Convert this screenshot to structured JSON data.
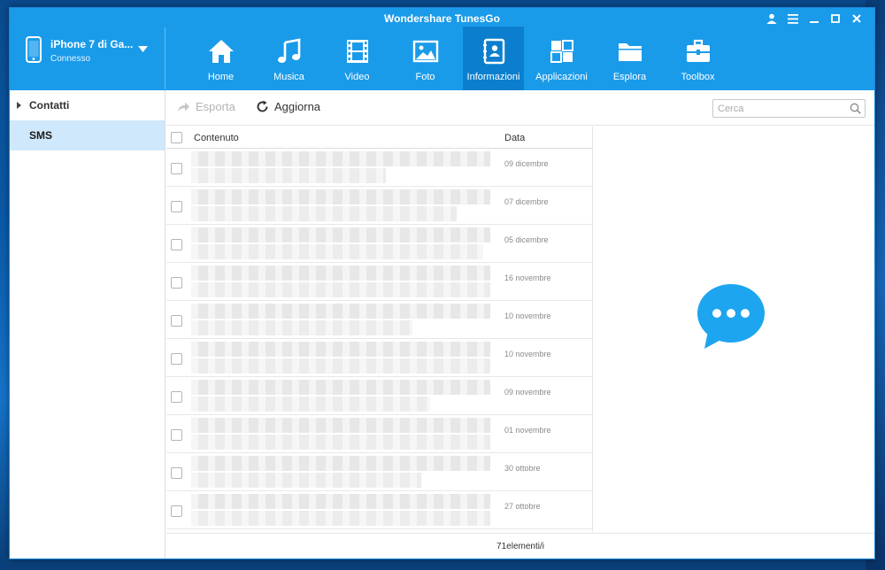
{
  "app": {
    "title": "Wondershare TunesGo"
  },
  "device": {
    "name": "iPhone 7 di Ga...",
    "status": "Connesso"
  },
  "nav": [
    {
      "label": "Home",
      "icon": "home-icon"
    },
    {
      "label": "Musica",
      "icon": "music-icon"
    },
    {
      "label": "Video",
      "icon": "film-icon"
    },
    {
      "label": "Foto",
      "icon": "photo-icon"
    },
    {
      "label": "Informazioni",
      "icon": "contacts-book-icon",
      "active": true
    },
    {
      "label": "Applicazioni",
      "icon": "apps-grid-icon"
    },
    {
      "label": "Esplora",
      "icon": "folder-icon"
    },
    {
      "label": "Toolbox",
      "icon": "toolbox-icon"
    }
  ],
  "sidebar": {
    "items": [
      {
        "label": "Contatti",
        "expandable": true
      },
      {
        "label": "SMS",
        "selected": true
      }
    ]
  },
  "toolbar": {
    "export_label": "Esporta",
    "refresh_label": "Aggiorna",
    "search_placeholder": "Cerca"
  },
  "list": {
    "columns": {
      "content": "Contenuto",
      "date": "Data"
    },
    "rows": [
      {
        "date": "09 dicembre"
      },
      {
        "date": "07 dicembre"
      },
      {
        "date": "05 dicembre"
      },
      {
        "date": "16 novembre"
      },
      {
        "date": "10 novembre"
      },
      {
        "date": "10 novembre"
      },
      {
        "date": "09 novembre"
      },
      {
        "date": "01 novembre"
      },
      {
        "date": "30 ottobre"
      },
      {
        "date": "27 ottobre"
      }
    ]
  },
  "footer": {
    "count_text": "71elementi/i"
  },
  "colors": {
    "header": "#1a9bea",
    "active_tab": "#0b7fcd",
    "selected_row": "#cfe8fb",
    "bubble": "#1da5ef"
  }
}
